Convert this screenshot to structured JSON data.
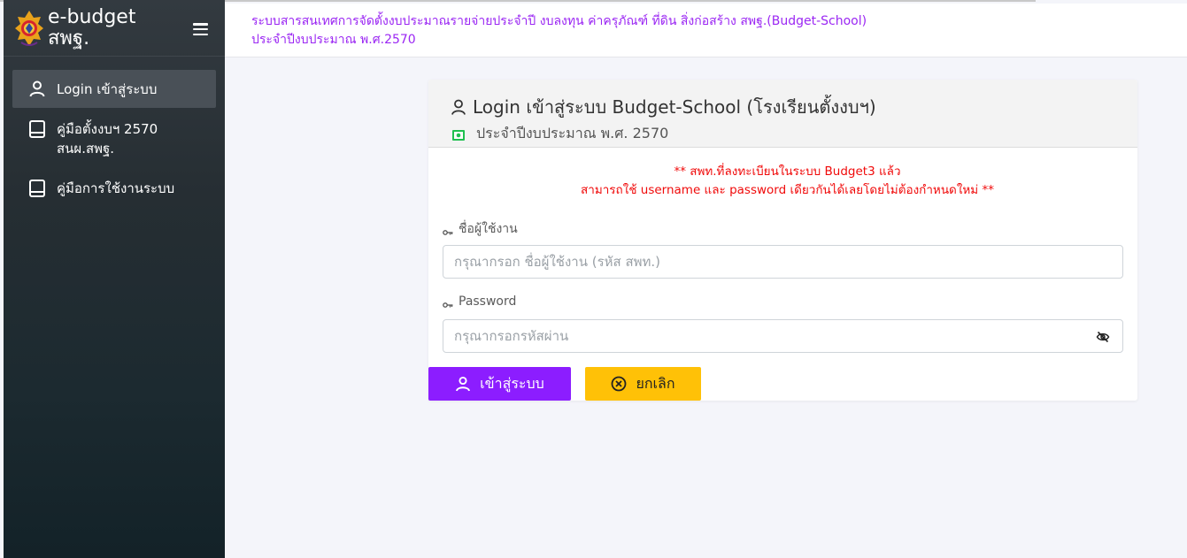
{
  "brand": {
    "title": "e-budget สพฐ.",
    "logo_icon": "school-emblem-icon"
  },
  "sidebar": {
    "items": [
      {
        "label": "Login เข้าสู่ระบบ",
        "icon": "user-icon",
        "active": true
      },
      {
        "label": "คู่มือตั้งงบฯ 2570 สนผ.สพฐ.",
        "icon": "book-icon",
        "active": false
      },
      {
        "label": "คู่มือการใช้งานระบบ",
        "icon": "book-icon",
        "active": false
      }
    ]
  },
  "header": {
    "line1": "ระบบสารสนเทศการจัดตั้งงบประมาณรายจ่ายประจำปี งบลงทุน ค่าครุภัณฑ์ ที่ดิน สิ่งก่อสร้าง สพฐ.(Budget-School)",
    "line2": "ประจำปีงบประมาณ พ.ศ.2570"
  },
  "card": {
    "title": "Login เข้าสู่ระบบ Budget-School (โรงเรียนตั้งงบฯ)",
    "subtitle": "ประจำปีงบประมาณ พ.ศ. 2570",
    "warning_line1": "** สพท.ที่ลงทะเบียนในระบบ Budget3 แล้ว",
    "warning_line2": "สามารถใช้ username และ password เดียวกันได้เลยโดยไม่ต้องกำหนดใหม่ **",
    "username_label": "ชื่อผู้ใช้งาน",
    "username_placeholder": "กรุณากรอก ชื่อผู้ใช้งาน (รหัส สพท.)",
    "username_value": "",
    "password_label": "Password",
    "password_placeholder": "กรุณากรอกรหัสผ่าน",
    "password_value": "",
    "login_button": "เข้าสู่ระบบ",
    "cancel_button": "ยกเลิก"
  },
  "colors": {
    "accent_purple": "#8c1dff",
    "header_text": "#9b27f3",
    "warning_red": "#f00a0a",
    "cancel_yellow": "#ffc107",
    "sidebar_bg": "#2c3338"
  }
}
